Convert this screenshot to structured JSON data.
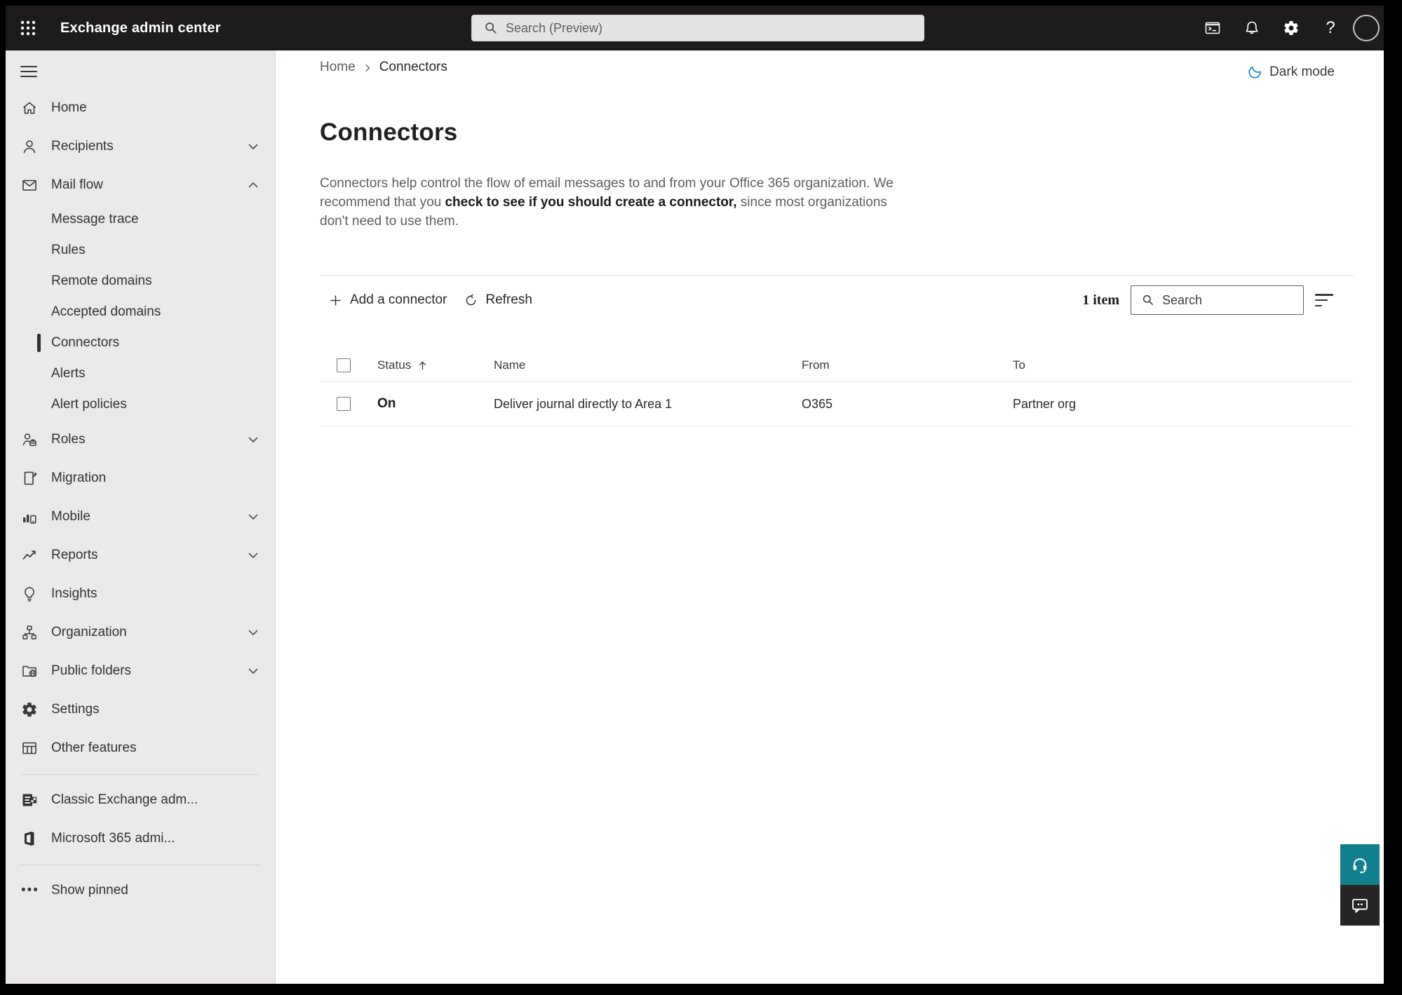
{
  "topbar": {
    "app_title": "Exchange admin center",
    "search_placeholder": "Search (Preview)"
  },
  "sidebar": {
    "items": [
      {
        "label": "Home",
        "icon": "home"
      },
      {
        "label": "Recipients",
        "icon": "person",
        "chevron": "down"
      },
      {
        "label": "Mail flow",
        "icon": "mail",
        "chevron": "up"
      },
      {
        "label": "Message trace",
        "indent": true
      },
      {
        "label": "Rules",
        "indent": true
      },
      {
        "label": "Remote domains",
        "indent": true
      },
      {
        "label": "Accepted domains",
        "indent": true
      },
      {
        "label": "Connectors",
        "indent": true,
        "selected": true
      },
      {
        "label": "Alerts",
        "indent": true
      },
      {
        "label": "Alert policies",
        "indent": true
      },
      {
        "label": "Roles",
        "icon": "person-briefcase",
        "chevron": "down"
      },
      {
        "label": "Migration",
        "icon": "page-arrow"
      },
      {
        "label": "Mobile",
        "icon": "bars-phone",
        "chevron": "down"
      },
      {
        "label": "Reports",
        "icon": "line-chart",
        "chevron": "down"
      },
      {
        "label": "Insights",
        "icon": "lightbulb"
      },
      {
        "label": "Organization",
        "icon": "org-chart",
        "chevron": "down"
      },
      {
        "label": "Public folders",
        "icon": "folder-globe",
        "chevron": "down"
      },
      {
        "label": "Settings",
        "icon": "gear"
      },
      {
        "label": "Other features",
        "icon": "table-grid"
      }
    ],
    "footer_items": [
      {
        "label": "Classic Exchange adm...",
        "icon": "exchange-logo"
      },
      {
        "label": "Microsoft 365 admi...",
        "icon": "m365-logo"
      },
      {
        "label": "Show pinned",
        "icon": "ellipsis"
      }
    ]
  },
  "header": {
    "breadcrumb_home": "Home",
    "breadcrumb_current": "Connectors",
    "dark_mode_label": "Dark mode"
  },
  "page": {
    "title": "Connectors",
    "description_part1": "Connectors help control the flow of email messages to and from your Office 365 organization. We recommend that you ",
    "description_strong": "check to see if you should create a connector,",
    "description_part2": " since most organizations don't need to use them."
  },
  "toolbar": {
    "add_label": "Add a connector",
    "refresh_label": "Refresh",
    "items_count": "1 item",
    "search_placeholder": "Search"
  },
  "table": {
    "columns": [
      "Status",
      "Name",
      "From",
      "To"
    ],
    "rows": [
      {
        "status": "On",
        "name": "Deliver journal directly to Area 1",
        "from": "O365",
        "to": "Partner org"
      }
    ]
  },
  "colors": {
    "accent_teal": "#10808c",
    "moon_blue": "#2286d4",
    "selected_indicator": "#31302e",
    "topbar_bg": "#1d1c1b"
  }
}
